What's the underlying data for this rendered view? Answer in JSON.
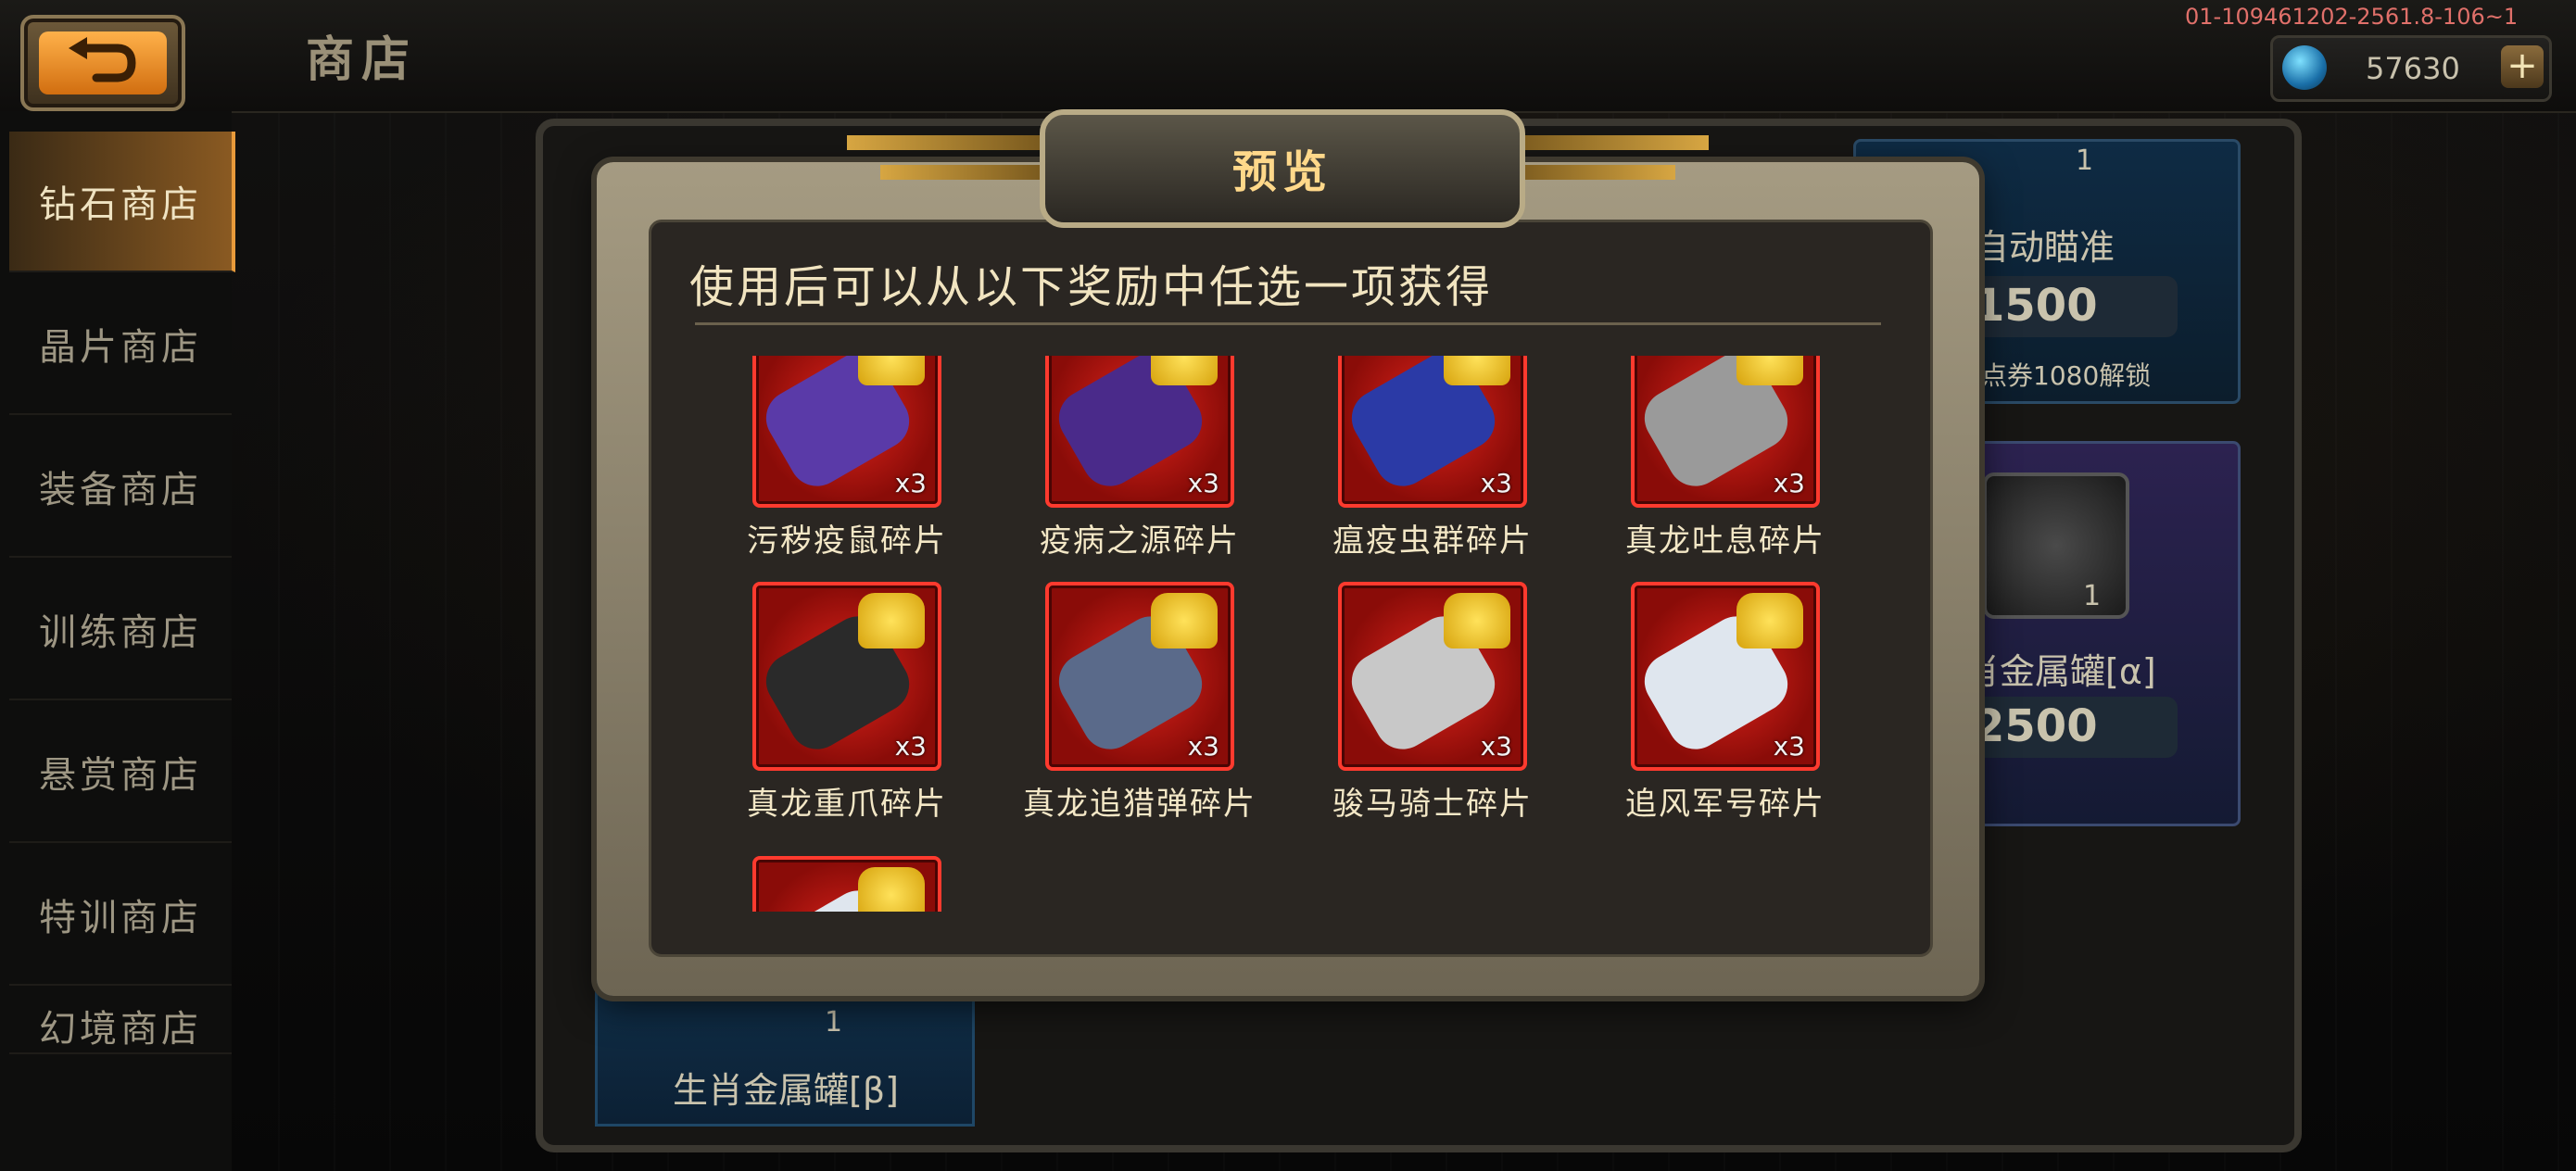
{
  "header": {
    "title": "商店",
    "debug_code": "01-109461202-2561.8-106~1",
    "currency_value": "57630",
    "plus_label": "+"
  },
  "sidebar": {
    "items": [
      {
        "label": "钻石商店",
        "active": true
      },
      {
        "label": "晶片商店",
        "active": false
      },
      {
        "label": "装备商店",
        "active": false
      },
      {
        "label": "训练商店",
        "active": false
      },
      {
        "label": "悬赏商店",
        "active": false
      },
      {
        "label": "特训商店",
        "active": false
      },
      {
        "label": "幻境商店",
        "active": false
      }
    ]
  },
  "background_shop": {
    "card_top_right": {
      "count": "1",
      "name": "自动瞄准",
      "price": "1500",
      "unlock_text": "值点券1080解锁"
    },
    "card_mid_right": {
      "count": "1",
      "name": "肖金属罐[α]",
      "price": "2500"
    },
    "card_bottom_left": {
      "count": "1",
      "name": "生肖金属罐[β]"
    }
  },
  "modal": {
    "title": "预览",
    "subtitle": "使用后可以从以下奖励中任选一项获得",
    "rewards": [
      {
        "name": "污秽疫鼠碎片",
        "count": "x3",
        "weapon_color": "#5a3aa8"
      },
      {
        "name": "疫病之源碎片",
        "count": "x3",
        "weapon_color": "#4a2a8a"
      },
      {
        "name": "瘟疫虫群碎片",
        "count": "x3",
        "weapon_color": "#2b3aa6"
      },
      {
        "name": "真龙吐息碎片",
        "count": "x3",
        "weapon_color": "#9a9a9a"
      },
      {
        "name": "真龙重爪碎片",
        "count": "x3",
        "weapon_color": "#2a2a2a"
      },
      {
        "name": "真龙追猎弹碎片",
        "count": "x3",
        "weapon_color": "#5a6a8a"
      },
      {
        "name": "骏马骑士碎片",
        "count": "x3",
        "weapon_color": "#c8c8c8"
      },
      {
        "name": "追风军号碎片",
        "count": "x3",
        "weapon_color": "#dfe6ee"
      },
      {
        "name": "",
        "count": "",
        "weapon_color": "#dfe6ee"
      }
    ]
  }
}
